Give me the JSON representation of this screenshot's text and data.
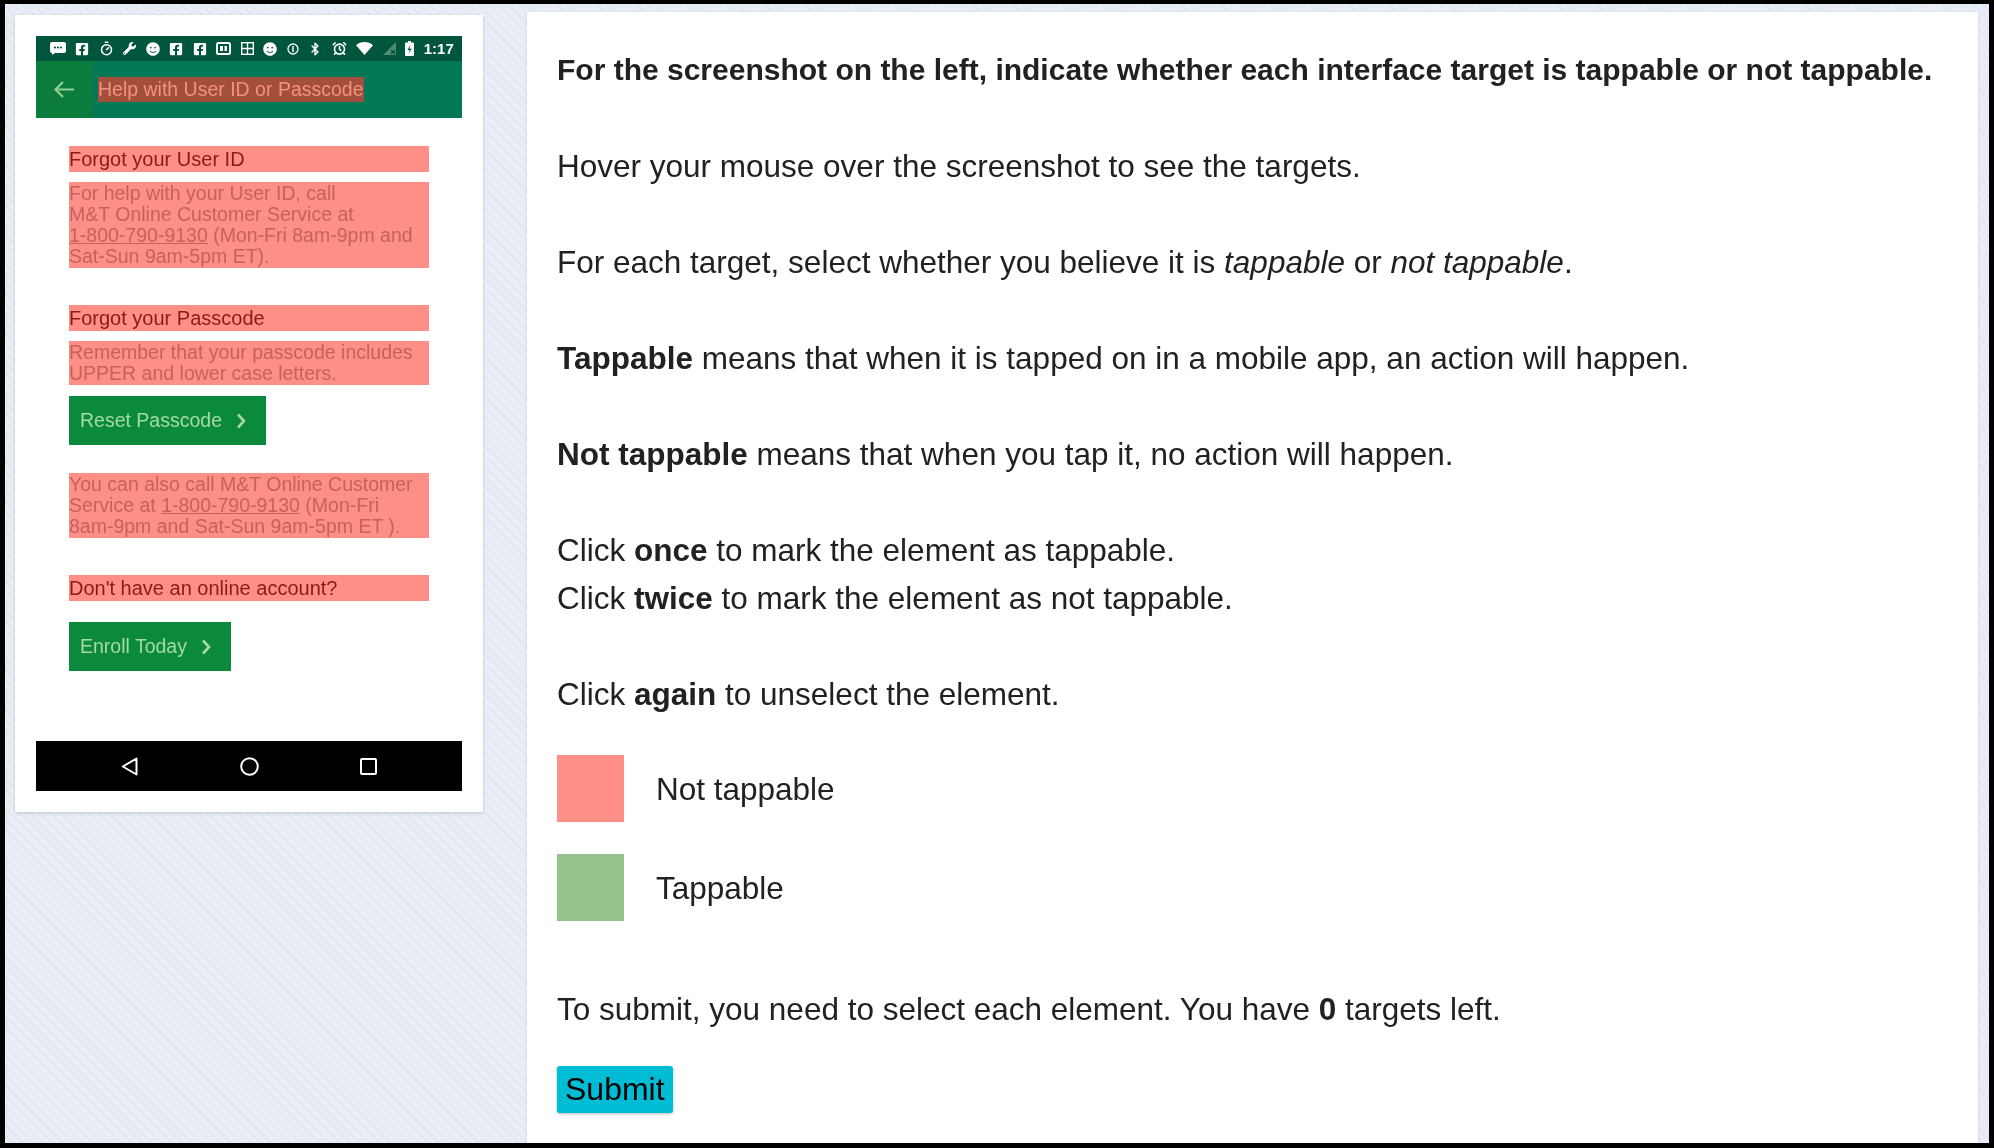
{
  "phone": {
    "status_bar": {
      "time": "1:17"
    },
    "app_bar": {
      "back": {
        "tappable": true
      },
      "title": {
        "text": "Help with User ID or Passcode",
        "tappable": false
      }
    },
    "content": [
      {
        "kind": "heading",
        "text": "Forgot your User ID",
        "tappable": false
      },
      {
        "kind": "paragraph",
        "text": "For help with your User ID, call\nM&T Online Customer Service at",
        "link": "1-800-790-9130",
        "text_after": "(Mon-Fri 8am-9pm and Sat-Sun 9am-5pm ET).",
        "tappable": false
      },
      {
        "kind": "heading",
        "text": "Forgot your Passcode",
        "tappable": false
      },
      {
        "kind": "paragraph",
        "text": "Remember that your passcode includes UPPER and lower case letters.",
        "tappable": false
      },
      {
        "kind": "button",
        "text": "Reset Passcode",
        "tappable": true
      },
      {
        "kind": "paragraph",
        "text": "You can also call M&T Online Customer Service at",
        "link": "1-800-790-9130",
        "text_after": "(Mon-Fri 8am-9pm and Sat-Sun 9am-5pm ET ).",
        "tappable": false
      },
      {
        "kind": "heading",
        "text": "Don't have an online account?",
        "tappable": false
      },
      {
        "kind": "button",
        "text": "Enroll Today",
        "tappable": true
      }
    ]
  },
  "instructions": {
    "title": "For the screenshot on the left, indicate whether each interface target is tappable or not tappable.",
    "paragraphs": [
      {
        "lines": [
          "Hover your mouse over the screenshot to see the targets."
        ]
      },
      {
        "lines": [
          "For each target, select whether you believe it is *tappable* or *not tappable*."
        ]
      },
      {
        "lines": [
          "**Tappable** means that when it is tapped on in a mobile app, an action will happen."
        ]
      },
      {
        "lines": [
          "**Not tappable** means that when you tap it, no action will happen."
        ]
      },
      {
        "lines": [
          "Click **once** to mark the element as tappable.",
          "Click **twice** to mark the element as not tappable."
        ]
      },
      {
        "lines": [
          "Click **again** to unselect the element."
        ]
      }
    ],
    "legend": [
      {
        "label": "Not tappable",
        "color": "#fe8f86"
      },
      {
        "label": "Tappable",
        "color": "#93c28b"
      }
    ],
    "submit_note": "To submit, you need to select each element. You have **0** targets left.",
    "submit_button": "Submit"
  }
}
